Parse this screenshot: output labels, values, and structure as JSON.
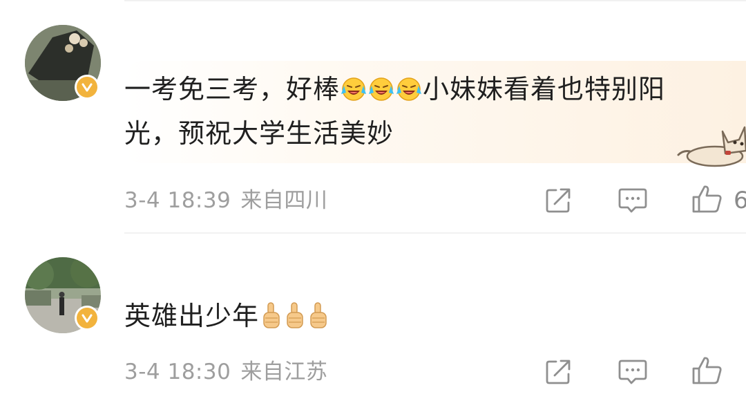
{
  "comments": [
    {
      "text_before_emoji": "一考免三考，好棒",
      "emoji_icon": "laughing-crying-face-icon",
      "emoji_count": 3,
      "text_after_emoji": "小妹妹看着也特别阳",
      "text_line2": "光，预祝大学生活美妙",
      "time": "3-4 18:39",
      "location": "来自四川",
      "like_count": "6"
    },
    {
      "text_before_emoji": "英雄出少年",
      "emoji_icon": "thumbs-up-emoji-icon",
      "emoji_count": 3,
      "time": "3-4 18:30",
      "location": "来自江苏",
      "like_count": ""
    }
  ],
  "colors": {
    "verify_badge": "#f2b33d",
    "meta_text": "#9e9e9e",
    "main_text": "#1f1f1f",
    "icon_stroke": "#8f8f8f"
  }
}
